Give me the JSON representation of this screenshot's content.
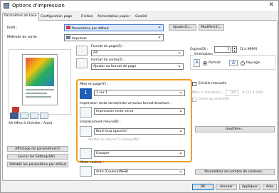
{
  "window": {
    "title": "Options d'impression"
  },
  "tabs": [
    "Paramètres de base",
    "Configuration page",
    "Finition",
    "Alimentation papier",
    "Qualité"
  ],
  "profile": {
    "label": "Profil :",
    "value": "Paramètres par défaut",
    "add": "Ajouter(1)...",
    "modify": "Modifier(2)..."
  },
  "output": {
    "label": "Méthode de sortie :",
    "value": "Imprimer"
  },
  "paper": {
    "format_label": "Format de page(S) :",
    "format_value": "A4",
    "output_label": "Format de sortie(Z) :",
    "output_value": "Ajuster au format de page"
  },
  "copies": {
    "label": "Copies(D) :",
    "value": "1",
    "range": "[1 à 9999]"
  },
  "orientation": {
    "label": "Orientation",
    "portrait": "Portrait",
    "landscape": "Paysage"
  },
  "pages": {
    "label": "Mise en page(Y) :",
    "value": "1 sur 1"
  },
  "scale": {
    "manual": "Echelle manuelle",
    "label": "Mise à l'échelle(L) :",
    "value": "100",
    "range": "% [25 à 200]",
    "center": "Ordre au centre(R)"
  },
  "duplex": {
    "label": "Impression recto verso/recto verso/au format brochure :",
    "value": "Impression recto verso"
  },
  "binding": {
    "label": "Emplacement reliure(B) :",
    "value": "Bord long (gauche)",
    "extra": "Ajuster la reliure(T) / marge(M)"
  },
  "gutter": {
    "label": "Gouttière..."
  },
  "preview": {
    "caption": "A4 (Mise à l'échelle : Auto)"
  },
  "left_buttons": {
    "settings_view": "Affichage de paramètres(V)",
    "printer_settings": "Lancer les Settings(W)...",
    "restore": "Rétablir les paramètres par défaut"
  },
  "group": {
    "value": "Grouper"
  },
  "color": {
    "label": "Mode couleur :",
    "value": "Auto (Couleur/N&B)",
    "details": "Paramètres de nombre de couleurs..."
  },
  "footer": {
    "ok": "OK",
    "cancel": "Annuler",
    "apply": "Appliquer",
    "help": "Aide"
  }
}
